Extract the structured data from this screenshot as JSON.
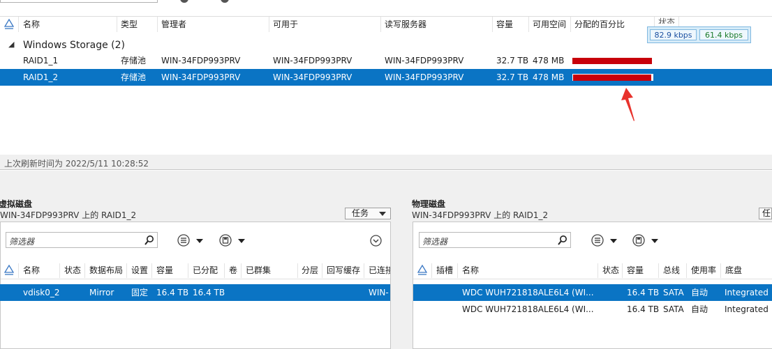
{
  "main_list": {
    "columns": [
      "名称",
      "类型",
      "管理者",
      "可用于",
      "读写服务器",
      "容量",
      "可用空间",
      "分配的百分比",
      "状态"
    ],
    "group": {
      "label": "Windows Storage (2)",
      "toggle": "◢"
    },
    "rows": [
      {
        "name": "RAID1_1",
        "type": "存储池",
        "manager": "WIN-34FDP993PRV",
        "available_to": "WIN-34FDP993PRV",
        "rw_server": "WIN-34FDP993PRV",
        "capacity": "32.7 TB",
        "free_space": "478 MB",
        "allocated_fraction": 0.985
      },
      {
        "name": "RAID1_2",
        "type": "存储池",
        "manager": "WIN-34FDP993PRV",
        "available_to": "WIN-34FDP993PRV",
        "rw_server": "WIN-34FDP993PRV",
        "capacity": "32.7 TB",
        "free_space": "478 MB",
        "allocated_fraction": 0.985
      }
    ]
  },
  "network_monitor": {
    "down": "82.9 kbps",
    "up": "61.4 kbps",
    "down_color": "#1a4fa0",
    "up_color": "#1a7a2a"
  },
  "status_bar": {
    "text": "上次刷新时间为 2022/5/11 10:28:52"
  },
  "virtual_disk_pane": {
    "title": "虚拟磁盘",
    "subtitle": "WIN-34FDP993PRV 上的 RAID1_2",
    "task_label": "任务",
    "filter_placeholder": "筛选器",
    "columns": [
      "名称",
      "状态",
      "数据布局",
      "设置",
      "容量",
      "已分配",
      "卷",
      "已群集",
      "分层",
      "回写缓存",
      "已连接"
    ],
    "rows": [
      {
        "name": "vdisk0_2",
        "layout": "Mirror",
        "setting": "固定",
        "capacity": "16.4 TB",
        "allocated": "16.4 TB",
        "connected": "WIN-"
      }
    ]
  },
  "physical_disk_pane": {
    "title": "物理磁盘",
    "subtitle": "WIN-34FDP993PRV 上的 RAID1_2",
    "task_label": "任",
    "filter_placeholder": "筛选器",
    "columns": [
      "插槽",
      "名称",
      "状态",
      "容量",
      "总线",
      "使用率",
      "底盘"
    ],
    "rows": [
      {
        "name": "WDC  WUH721818ALE6L4 (WI...",
        "capacity": "16.4 TB",
        "bus": "SATA",
        "usage": "自动",
        "chassis": "Integrated :"
      },
      {
        "name": "WDC  WUH721818ALE6L4 (WI...",
        "capacity": "16.4 TB",
        "bus": "SATA",
        "usage": "自动",
        "chassis": "Integrated :"
      }
    ]
  },
  "colors": {
    "selection": "#0a74c4",
    "bar": "#c8000a",
    "annotation_arrow": "#e8322c"
  }
}
